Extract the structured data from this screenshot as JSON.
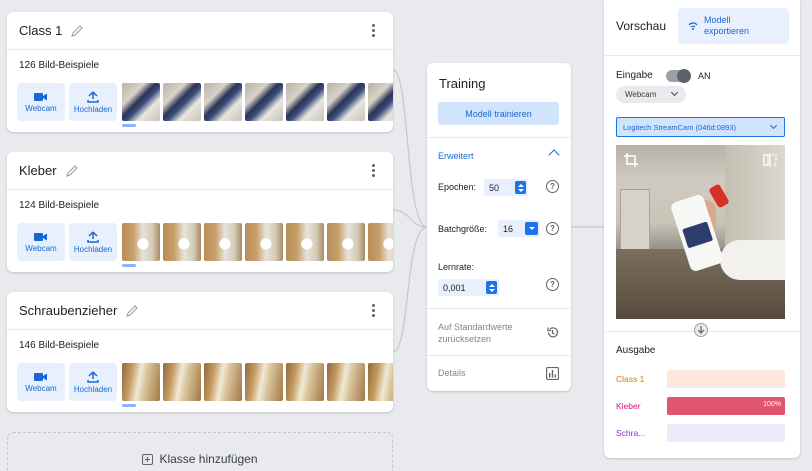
{
  "classes": [
    {
      "name": "Class 1",
      "count": "126 Bild-Beispiele",
      "thumb_style": "c1"
    },
    {
      "name": "Kleber",
      "count": "124 Bild-Beispiele",
      "thumb_style": "c2"
    },
    {
      "name": "Schraubenzieher",
      "count": "146 Bild-Beispiele",
      "thumb_style": "c3"
    }
  ],
  "sources": {
    "webcam": "Webcam",
    "upload": "Hochladen"
  },
  "add_class": "Klasse hinzufügen",
  "training": {
    "title": "Training",
    "train_button": "Modell trainieren",
    "advanced": "Erweitert",
    "epochs_label": "Epochen:",
    "epochs_value": "50",
    "batch_label": "Batchgröße:",
    "batch_value": "16",
    "lr_label": "Lernrate:",
    "lr_value": "0,001",
    "reset": "Auf Standardwerte zurücksetzen",
    "details": "Details",
    "help": "?"
  },
  "preview": {
    "title": "Vorschau",
    "export_button": "Modell exportieren",
    "input_label": "Eingabe",
    "toggle_state": "AN",
    "source_select": "Webcam",
    "camera_select": "Logitech StreamCam (046d:0893)",
    "output_label": "Ausgabe",
    "outputs": [
      {
        "name": "Class 1",
        "color": "#e37400",
        "bg": "#fde8db",
        "value": 0,
        "pct": ""
      },
      {
        "name": "Kleber",
        "color": "#d01884",
        "bg": "#f6d3de",
        "value": 1.0,
        "pct": "100%"
      },
      {
        "name": "Schra...",
        "color": "#8430ce",
        "bg": "#efe8fb",
        "value": 0,
        "pct": ""
      }
    ]
  },
  "colors": {
    "accent": "#1a73e8",
    "kleber_fill": "#e0566f"
  }
}
